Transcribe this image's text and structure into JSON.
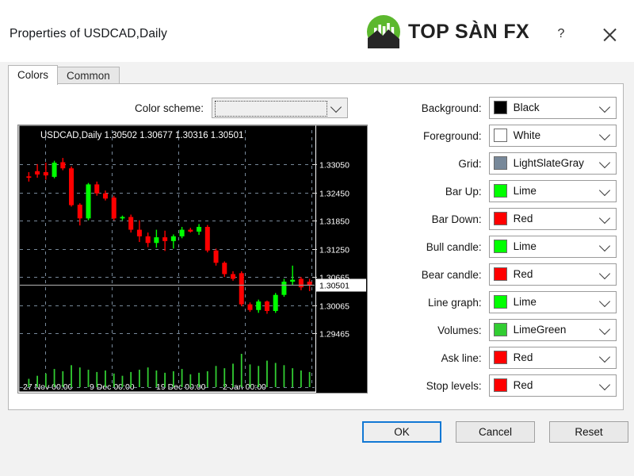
{
  "window": {
    "title": "Properties of USDCAD,Daily",
    "help_label": "?",
    "close_label": "×"
  },
  "brand": {
    "name": "TOP SÀN FX",
    "logo_icon": "green-circle-bars-mountain-logo"
  },
  "tabs": [
    {
      "label": "Colors",
      "active": true
    },
    {
      "label": "Common",
      "active": false
    }
  ],
  "color_scheme": {
    "label": "Color scheme:",
    "value": "",
    "placeholder": ""
  },
  "fields": [
    {
      "label": "Background:",
      "value": "Black",
      "color": "#000000"
    },
    {
      "label": "Foreground:",
      "value": "White",
      "color": "#ffffff"
    },
    {
      "label": "Grid:",
      "value": "LightSlateGray",
      "color": "#778899"
    },
    {
      "label": "Bar Up:",
      "value": "Lime",
      "color": "#00ff00"
    },
    {
      "label": "Bar Down:",
      "value": "Red",
      "color": "#ff0000"
    },
    {
      "label": "Bull candle:",
      "value": "Lime",
      "color": "#00ff00"
    },
    {
      "label": "Bear candle:",
      "value": "Red",
      "color": "#ff0000"
    },
    {
      "label": "Line graph:",
      "value": "Lime",
      "color": "#00ff00"
    },
    {
      "label": "Volumes:",
      "value": "LimeGreen",
      "color": "#32cd32"
    },
    {
      "label": "Ask line:",
      "value": "Red",
      "color": "#ff0000"
    },
    {
      "label": "Stop levels:",
      "value": "Red",
      "color": "#ff0000"
    }
  ],
  "buttons": {
    "ok": "OK",
    "cancel": "Cancel",
    "reset": "Reset"
  },
  "chart_data": {
    "type": "candlestick",
    "title": "USDCAD,Daily  1.30502 1.30677 1.30316 1.30501",
    "symbol": "USDCAD,Daily",
    "ohlc": {
      "open": "1.30502",
      "high": "1.30677",
      "low": "1.30316",
      "close": "1.30501"
    },
    "background": "#000000",
    "grid_color": "#778899",
    "bull_color": "#00ff00",
    "bear_color": "#ff0000",
    "volume_color": "#32cd32",
    "price_line": "1.30501",
    "price_line_color": "#9a9a9a",
    "y_ticks": [
      "1.33050",
      "1.32450",
      "1.31850",
      "1.31250",
      "1.30665",
      "1.30065",
      "1.29465"
    ],
    "ylim": [
      1.292,
      1.334
    ],
    "current_price_label": "1.30501",
    "x_ticks": [
      "27 Nov 00:00",
      "9 Dec 00:00",
      "19 Dec 00:00",
      "2 Jan 00:00"
    ],
    "grid": true,
    "candles": [
      {
        "o": 1.3279,
        "h": 1.3288,
        "l": 1.3268,
        "c": 1.3276
      },
      {
        "o": 1.329,
        "h": 1.3305,
        "l": 1.3276,
        "c": 1.3283
      },
      {
        "o": 1.3288,
        "h": 1.3308,
        "l": 1.3272,
        "c": 1.3281
      },
      {
        "o": 1.3278,
        "h": 1.3312,
        "l": 1.3275,
        "c": 1.3308
      },
      {
        "o": 1.3309,
        "h": 1.3318,
        "l": 1.3292,
        "c": 1.3296
      },
      {
        "o": 1.3296,
        "h": 1.33,
        "l": 1.3215,
        "c": 1.3218
      },
      {
        "o": 1.3219,
        "h": 1.3222,
        "l": 1.3175,
        "c": 1.319
      },
      {
        "o": 1.319,
        "h": 1.3265,
        "l": 1.3186,
        "c": 1.3262
      },
      {
        "o": 1.3262,
        "h": 1.3268,
        "l": 1.3238,
        "c": 1.3243
      },
      {
        "o": 1.3243,
        "h": 1.3249,
        "l": 1.3228,
        "c": 1.3232
      },
      {
        "o": 1.3234,
        "h": 1.3238,
        "l": 1.3186,
        "c": 1.319
      },
      {
        "o": 1.319,
        "h": 1.3196,
        "l": 1.3186,
        "c": 1.3193
      },
      {
        "o": 1.3193,
        "h": 1.3198,
        "l": 1.316,
        "c": 1.3166
      },
      {
        "o": 1.3166,
        "h": 1.3186,
        "l": 1.314,
        "c": 1.3152
      },
      {
        "o": 1.3152,
        "h": 1.316,
        "l": 1.3129,
        "c": 1.3138
      },
      {
        "o": 1.3138,
        "h": 1.3166,
        "l": 1.3128,
        "c": 1.315
      },
      {
        "o": 1.315,
        "h": 1.3164,
        "l": 1.3121,
        "c": 1.3142
      },
      {
        "o": 1.3142,
        "h": 1.3156,
        "l": 1.3126,
        "c": 1.3152
      },
      {
        "o": 1.3152,
        "h": 1.3172,
        "l": 1.3148,
        "c": 1.3166
      },
      {
        "o": 1.3166,
        "h": 1.317,
        "l": 1.316,
        "c": 1.3162
      },
      {
        "o": 1.3162,
        "h": 1.3178,
        "l": 1.3155,
        "c": 1.3172
      },
      {
        "o": 1.3172,
        "h": 1.3176,
        "l": 1.3118,
        "c": 1.3122
      },
      {
        "o": 1.3122,
        "h": 1.3126,
        "l": 1.309,
        "c": 1.3096
      },
      {
        "o": 1.3096,
        "h": 1.3099,
        "l": 1.3066,
        "c": 1.3072
      },
      {
        "o": 1.3072,
        "h": 1.3078,
        "l": 1.3058,
        "c": 1.3062
      },
      {
        "o": 1.3074,
        "h": 1.3078,
        "l": 1.3004,
        "c": 1.3008
      },
      {
        "o": 1.3008,
        "h": 1.3012,
        "l": 1.2992,
        "c": 1.2996
      },
      {
        "o": 1.2996,
        "h": 1.3018,
        "l": 1.299,
        "c": 1.3014
      },
      {
        "o": 1.3014,
        "h": 1.3016,
        "l": 1.2988,
        "c": 1.2994
      },
      {
        "o": 1.2994,
        "h": 1.3032,
        "l": 1.299,
        "c": 1.3028
      },
      {
        "o": 1.3028,
        "h": 1.3062,
        "l": 1.3024,
        "c": 1.3056
      },
      {
        "o": 1.3056,
        "h": 1.309,
        "l": 1.3048,
        "c": 1.306
      },
      {
        "o": 1.3062,
        "h": 1.3066,
        "l": 1.3038,
        "c": 1.3044
      },
      {
        "o": 1.3056,
        "h": 1.3062,
        "l": 1.3036,
        "c": 1.3048
      }
    ],
    "volumes": [
      22,
      30,
      36,
      48,
      42,
      58,
      52,
      46,
      40,
      44,
      36,
      30,
      40,
      46,
      52,
      44,
      38,
      42,
      48,
      34,
      38,
      42,
      56,
      50,
      62,
      88,
      60,
      56,
      70,
      64,
      58,
      50,
      44,
      40
    ]
  }
}
